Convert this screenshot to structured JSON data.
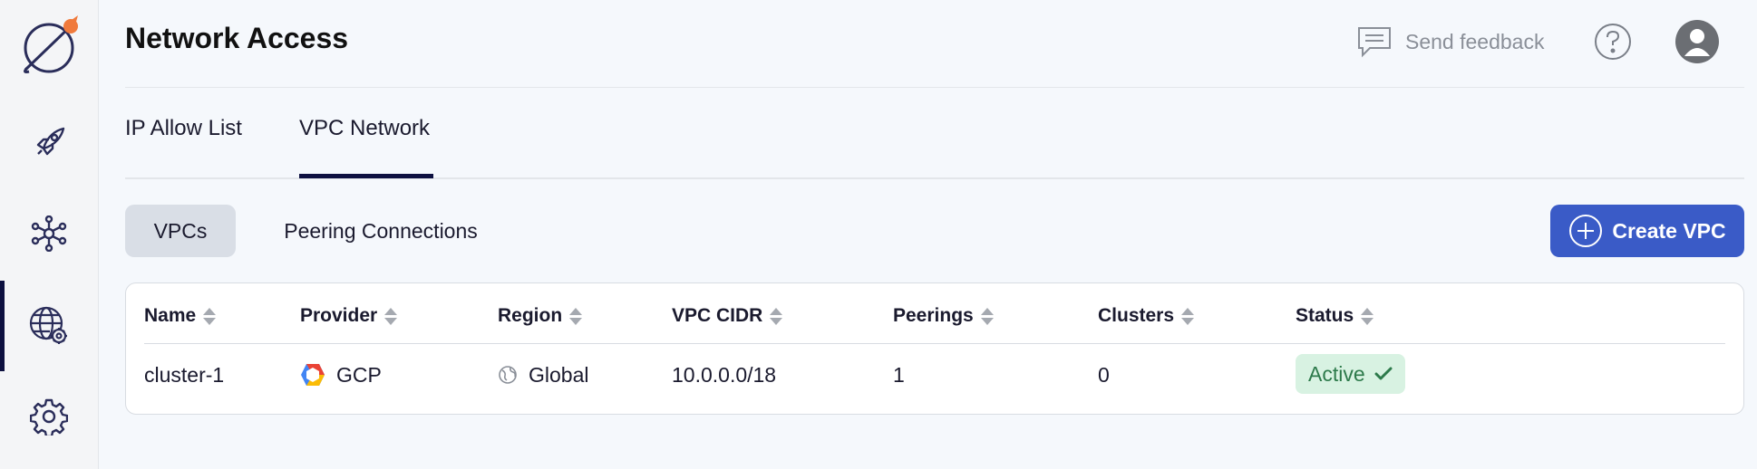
{
  "header": {
    "title": "Network Access",
    "feedback_label": "Send feedback"
  },
  "tabs": [
    {
      "label": "IP Allow List"
    },
    {
      "label": "VPC Network"
    }
  ],
  "subtabs": [
    {
      "label": "VPCs"
    },
    {
      "label": "Peering Connections"
    }
  ],
  "create_button": {
    "label": "Create VPC"
  },
  "table": {
    "columns": [
      "Name",
      "Provider",
      "Region",
      "VPC CIDR",
      "Peerings",
      "Clusters",
      "Status"
    ],
    "rows": [
      {
        "name": "cluster-1",
        "provider": "GCP",
        "region": "Global",
        "cidr": "10.0.0.0/18",
        "peerings": "1",
        "clusters": "0",
        "status": "Active"
      }
    ]
  },
  "colors": {
    "accent": "#3a5bc7",
    "nav_active": "#0d1040",
    "status_active_bg": "#d8f2e2",
    "status_active_text": "#2d7a4b",
    "logo_orange": "#f07a3c"
  },
  "sidebar": {
    "icons": [
      "logo-icon",
      "rocket-icon",
      "network-icon",
      "globe-gear-icon",
      "settings-icon"
    ],
    "active_index": 3
  }
}
